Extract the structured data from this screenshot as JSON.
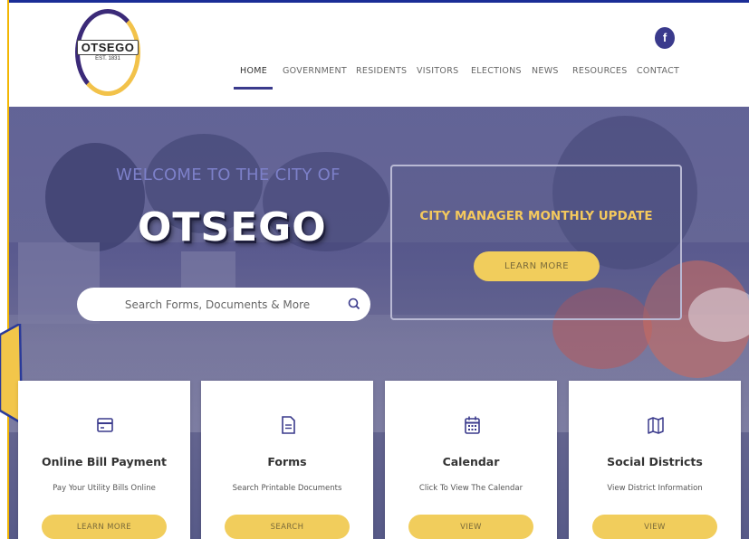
{
  "brand": {
    "logo_text": "OTSEGO",
    "logo_est": "EST. 1831",
    "primary_color": "#3a3a8c",
    "accent_color": "#f1cd5c"
  },
  "social": {
    "facebook_icon": "facebook-icon",
    "facebook_label": "f"
  },
  "nav": {
    "items": [
      "HOME",
      "GOVERNMENT",
      "RESIDENTS",
      "VISITORS",
      "ELECTIONS",
      "NEWS",
      "RESOURCES",
      "CONTACT"
    ],
    "active": "HOME"
  },
  "hero": {
    "welcome": "WELCOME TO THE CITY OF",
    "title": "OTSEGO",
    "search_placeholder": "Search Forms, Documents & More",
    "search_icon": "search-icon",
    "update_title": "CITY MANAGER MONTHLY UPDATE",
    "update_button": "LEARN MORE"
  },
  "cards": [
    {
      "icon": "credit-card-icon",
      "title": "Online Bill Payment",
      "subtitle": "Pay Your Utility Bills Online",
      "button": "LEARN MORE"
    },
    {
      "icon": "document-icon",
      "title": "Forms",
      "subtitle": "Search Printable Documents",
      "button": "SEARCH"
    },
    {
      "icon": "calendar-icon",
      "title": "Calendar",
      "subtitle": "Click To View The Calendar",
      "button": "VIEW"
    },
    {
      "icon": "map-icon",
      "title": "Social Districts",
      "subtitle": "View District Information",
      "button": "VIEW"
    }
  ]
}
